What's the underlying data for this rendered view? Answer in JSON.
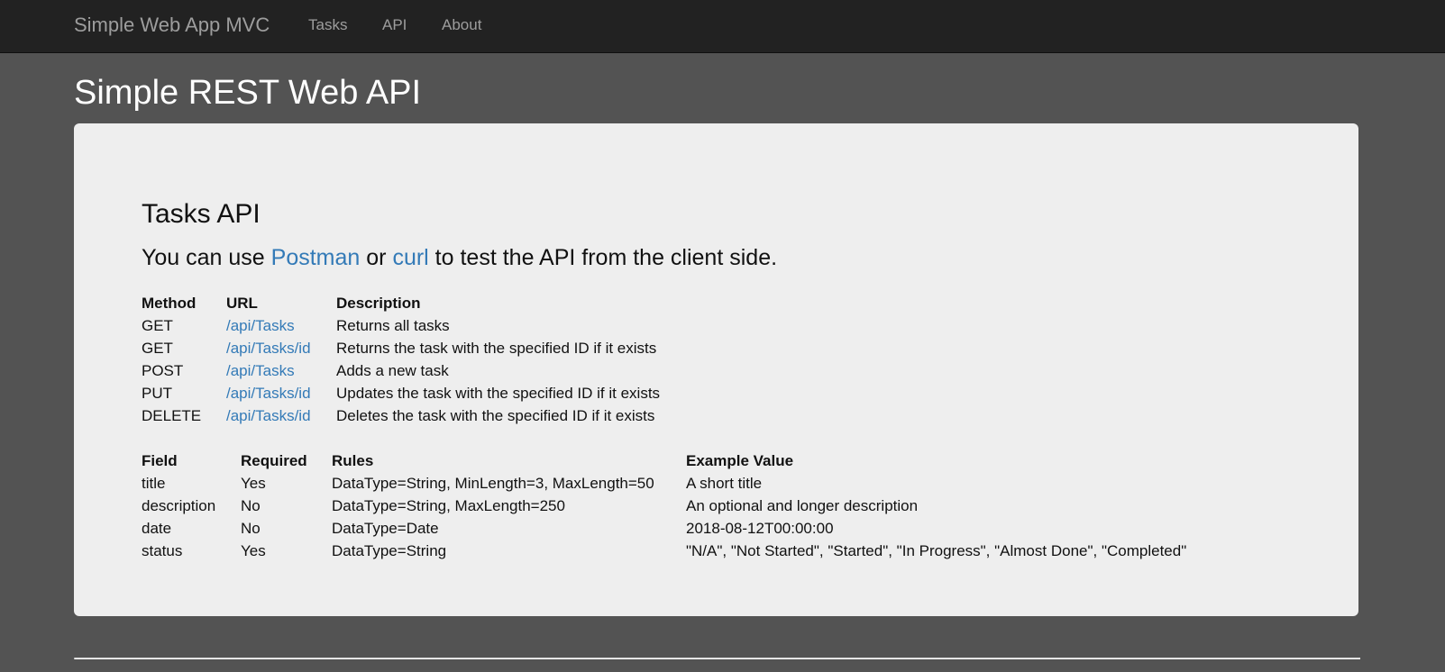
{
  "navbar": {
    "brand": "Simple Web App MVC",
    "links": [
      "Tasks",
      "API",
      "About"
    ]
  },
  "page": {
    "title": "Simple REST Web API"
  },
  "panel": {
    "heading": "Tasks API",
    "lead_prefix": "You can use ",
    "lead_link1": "Postman",
    "lead_middle": " or ",
    "lead_link2": "curl",
    "lead_suffix": " to test the API from the client side."
  },
  "endpoints": {
    "headers": [
      "Method",
      "URL",
      "Description"
    ],
    "rows": [
      [
        "GET",
        "/api/Tasks",
        "Returns all tasks"
      ],
      [
        "GET",
        "/api/Tasks/id",
        "Returns the task with the specified ID if it exists"
      ],
      [
        "POST",
        "/api/Tasks",
        "Adds a new task"
      ],
      [
        "PUT",
        "/api/Tasks/id",
        "Updates the task with the specified ID if it exists"
      ],
      [
        "DELETE",
        "/api/Tasks/id",
        "Deletes the task with the specified ID if it exists"
      ]
    ]
  },
  "fields": {
    "headers": [
      "Field",
      "Required",
      "Rules",
      "Example Value"
    ],
    "rows": [
      [
        "title",
        "Yes",
        "DataType=String, MinLength=3, MaxLength=50",
        "A short title"
      ],
      [
        "description",
        "No",
        "DataType=String, MaxLength=250",
        "An optional and longer description"
      ],
      [
        "date",
        "No",
        "DataType=Date",
        "2018-08-12T00:00:00"
      ],
      [
        "status",
        "Yes",
        "DataType=String",
        "\"N/A\", \"Not Started\", \"Started\", \"In Progress\", \"Almost Done\", \"Completed\""
      ]
    ]
  },
  "colors": {
    "background": "#535353",
    "navbar": "#222222",
    "panel": "#eeeeee",
    "link": "#337ab7"
  }
}
